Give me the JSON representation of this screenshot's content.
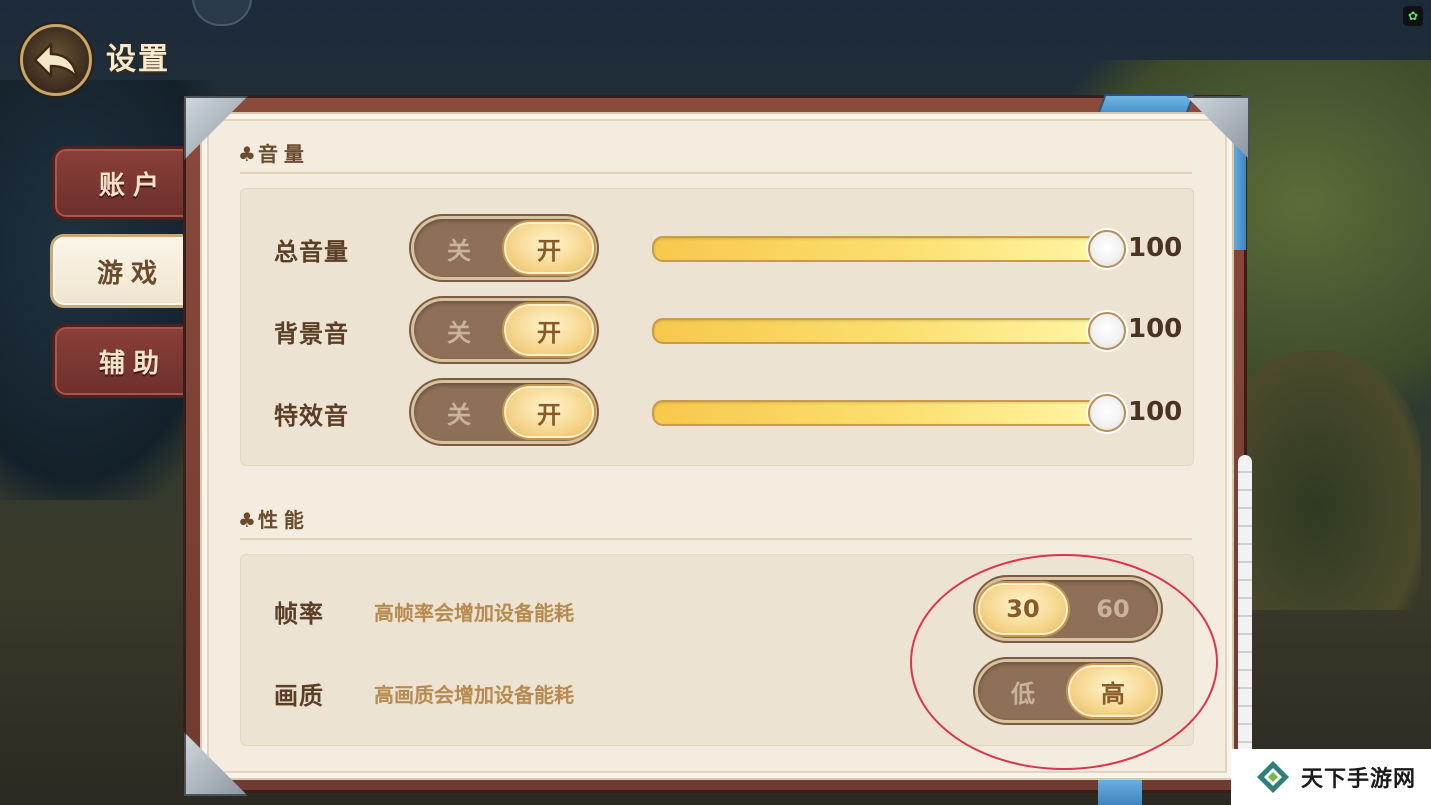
{
  "header": {
    "title": "设置"
  },
  "tabs": [
    {
      "label": "账户",
      "active": false
    },
    {
      "label": "游戏",
      "active": true
    },
    {
      "label": "辅助",
      "active": false
    }
  ],
  "volume": {
    "section_title": "音量",
    "rows": [
      {
        "label": "总音量",
        "off": "关",
        "on": "开",
        "state": "开",
        "value": 100,
        "value_text": "100"
      },
      {
        "label": "背景音",
        "off": "关",
        "on": "开",
        "state": "开",
        "value": 100,
        "value_text": "100"
      },
      {
        "label": "特效音",
        "off": "关",
        "on": "开",
        "state": "开",
        "value": 100,
        "value_text": "100"
      }
    ]
  },
  "performance": {
    "section_title": "性能",
    "rows": [
      {
        "label": "帧率",
        "hint": "高帧率会增加设备能耗",
        "options": [
          "30",
          "60"
        ],
        "selected": "30"
      },
      {
        "label": "画质",
        "hint": "高画质会增加设备能耗",
        "options": [
          "低",
          "高"
        ],
        "selected": "高"
      }
    ]
  },
  "watermark": {
    "text": "天下手游网"
  },
  "colors": {
    "accent_gold": "#f6d68e",
    "tab_inactive": "#8a3f3a",
    "annotation": "#e0334f"
  }
}
